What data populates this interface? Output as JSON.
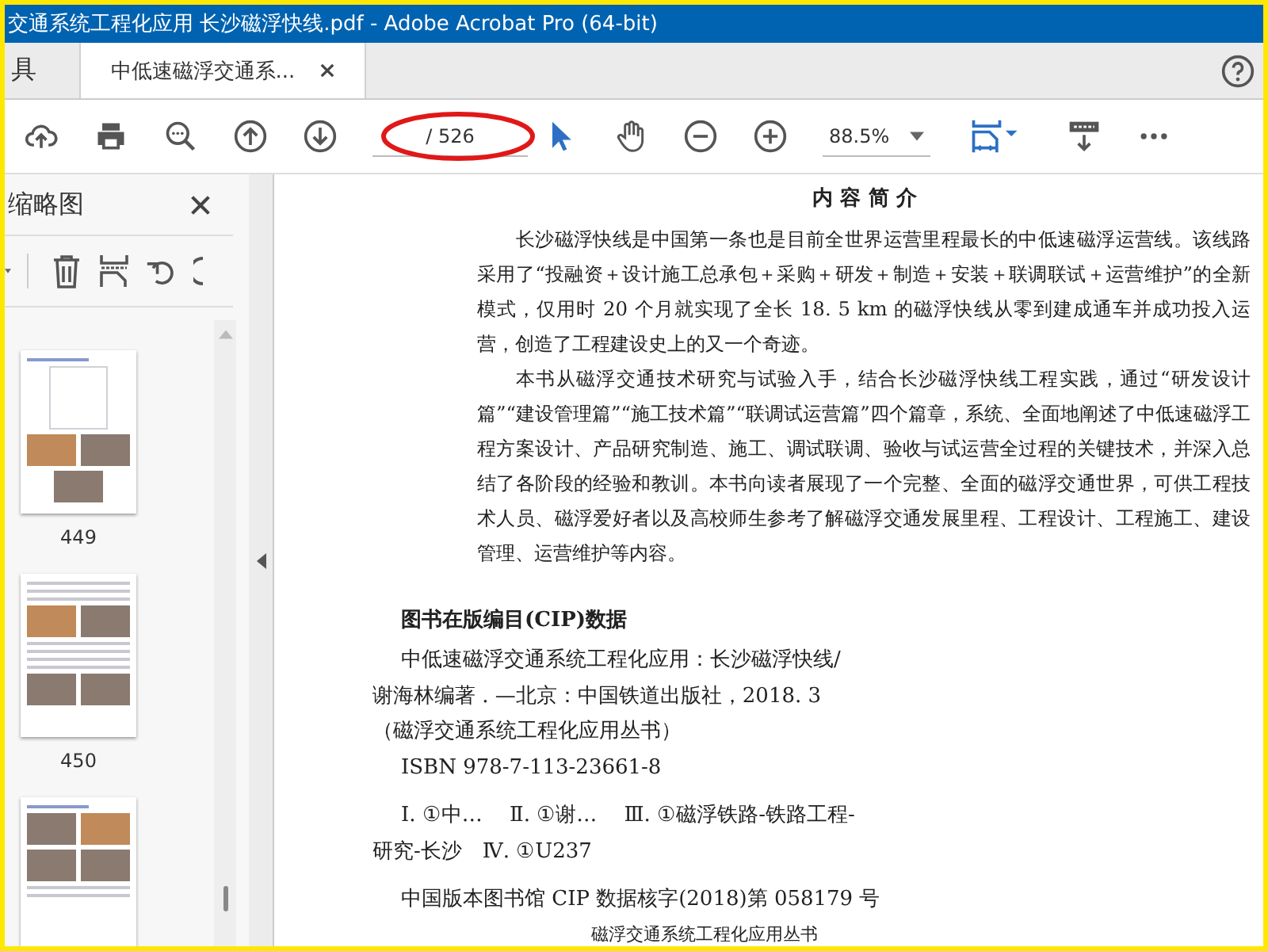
{
  "window": {
    "title": "交通系统工程化应用  长沙磁浮快线.pdf - Adobe Acrobat Pro (64-bit)"
  },
  "tabs": [
    {
      "label": "具",
      "selected": false
    },
    {
      "label": "中低速磁浮交通系...",
      "selected": true
    }
  ],
  "toolbar": {
    "page_total": "/ 526",
    "page_highlight": {
      "kind": "ellipse"
    },
    "zoom": "88.5%",
    "tools": [
      {
        "kind": "select",
        "selected": true
      },
      {
        "kind": "hand",
        "selected": false
      }
    ]
  },
  "sidebar": {
    "title": "缩略图",
    "thumbnails": [
      {
        "kind": "figures",
        "label": "449"
      },
      {
        "kind": "text-photos",
        "label": "450"
      },
      {
        "kind": "photos"
      }
    ]
  },
  "document": {
    "heading": "内 容 简 介",
    "paragraphs": [
      "长沙磁浮快线是中国第一条也是目前全世界运营里程最长的中低速磁浮运营线。该线路采用了“投融资＋设计施工总承包＋采购＋研发＋制造＋安装＋联调联试＋运营维护”的全新模式，仅用时 20 个月就实现了全长 18. 5 km 的磁浮快线从零到建成通车并成功投入运营，创造了工程建设史上的又一个奇迹。",
      "本书从磁浮交通技术研究与试验入手，结合长沙磁浮快线工程实践，通过“研发设计篇”“建设管理篇”“施工技术篇”“联调试运营篇”四个篇章，系统、全面地阐述了中低速磁浮工程方案设计、产品研究制造、施工、调试联调、验收与试运营全过程的关键技术，并深入总结了各阶段的经验和教训。本书向读者展现了一个完整、全面的磁浮交通世界，可供工程技术人员、磁浮爱好者以及高校师生参考了解磁浮交通发展里程、工程设计、工程施工、建设管理、运营维护等内容。"
    ],
    "cip_heading": "图书在版编目(CIP)数据",
    "cip_lines": [
      {
        "text": "中低速磁浮交通系统工程化应用：长沙磁浮快线/",
        "indent": true,
        "space_before": false
      },
      {
        "text": "谢海林编著 . —北京：中国铁道出版社，2018. 3",
        "indent": false,
        "space_before": false
      },
      {
        "text": "（磁浮交通系统工程化应用丛书）",
        "indent": false,
        "space_before": false
      },
      {
        "text": "ISBN 978-7-113-23661-8",
        "indent": true,
        "space_before": false
      },
      {
        "text": "Ⅰ. ①中…　 Ⅱ. ①谢…　 Ⅲ. ①磁浮铁路-铁路工程-",
        "indent": true,
        "space_before": true
      },
      {
        "text": "研究-长沙　Ⅳ. ①U237",
        "indent": false,
        "space_before": false
      },
      {
        "text": "中国版本图书馆 CIP 数据核字(2018)第 058179 号",
        "indent": true,
        "space_before": true
      }
    ],
    "series_line": "磁浮交通系统工程化应用丛书"
  }
}
